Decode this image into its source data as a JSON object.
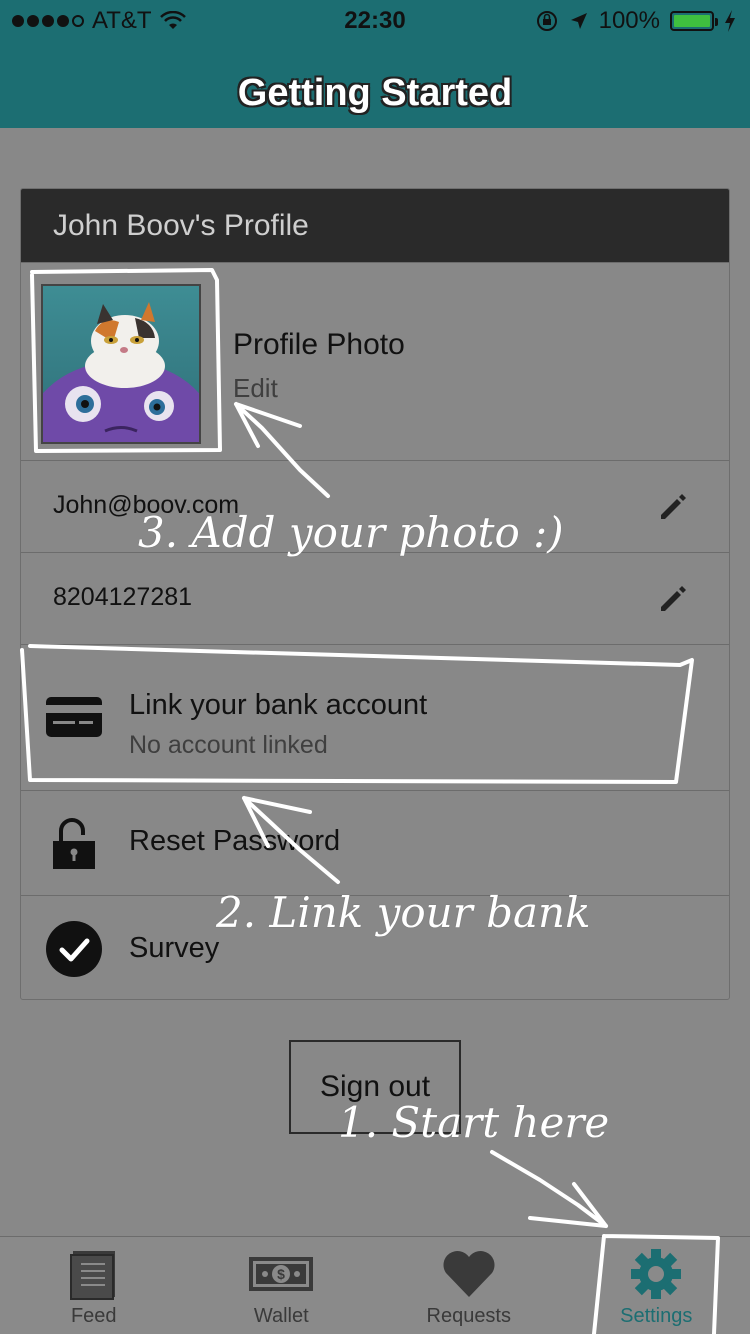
{
  "status_bar": {
    "carrier": "AT&T",
    "time": "22:30",
    "battery": "100%",
    "signal_bars": 4
  },
  "header": {
    "title": "Getting Started"
  },
  "profile": {
    "title": "John Boov's Profile",
    "photo_label": "Profile Photo",
    "photo_action": "Edit",
    "email": "John@boov.com",
    "phone": "8204127281",
    "bank_title": "Link your bank account",
    "bank_status": "No account linked",
    "reset_label": "Reset Password",
    "survey_label": "Survey"
  },
  "sign_out_label": "Sign out",
  "tabs": [
    {
      "label": "Feed",
      "icon": "feed-icon",
      "active": false
    },
    {
      "label": "Wallet",
      "icon": "wallet-icon",
      "active": false
    },
    {
      "label": "Requests",
      "icon": "heart-icon",
      "active": false
    },
    {
      "label": "Settings",
      "icon": "gear-icon",
      "active": true
    }
  ],
  "annotations": {
    "step1": "1. Start here",
    "step2": "2. Link your bank",
    "step3": "3. Add your photo :)"
  },
  "colors": {
    "brand": "#1c6e72",
    "overlay": "#888888",
    "battery": "#3fbf3f"
  }
}
